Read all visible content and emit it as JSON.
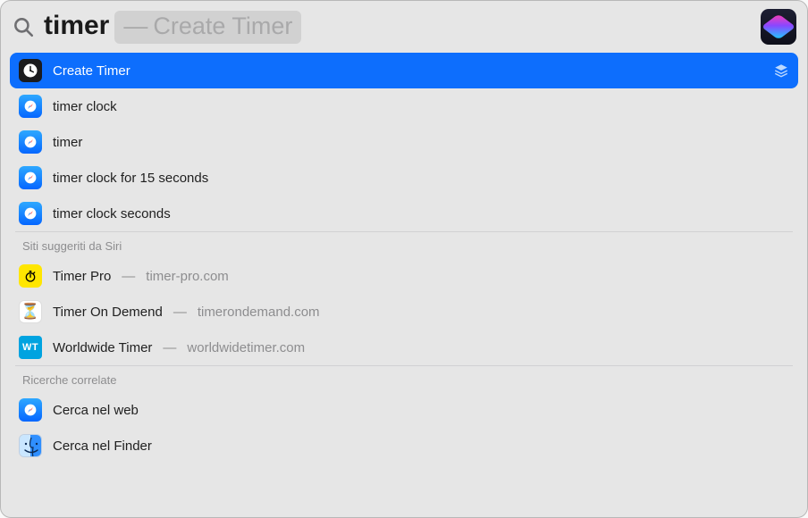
{
  "search": {
    "query": "timer",
    "suggestion_separator": "—",
    "suggestion_text": "Create Timer",
    "app_badge_name": "shortcuts-app-icon"
  },
  "results_primary": [
    {
      "title": "Create Timer",
      "icon": "clock-app-icon",
      "selected": true,
      "trailing_icon": "layers-icon"
    },
    {
      "title": "timer clock",
      "icon": "safari-icon"
    },
    {
      "title": "timer",
      "icon": "safari-icon"
    },
    {
      "title": "timer clock for 15 seconds",
      "icon": "safari-icon"
    },
    {
      "title": "timer clock seconds",
      "icon": "safari-icon"
    }
  ],
  "sections": [
    {
      "header": "Siti suggeriti da Siri",
      "items": [
        {
          "title": "Timer Pro",
          "subtitle_sep": "—",
          "subtitle": "timer-pro.com",
          "icon": "stopwatch-icon"
        },
        {
          "title": "Timer On Demend",
          "subtitle_sep": "—",
          "subtitle": "timerondemand.com",
          "icon": "hourglass-icon"
        },
        {
          "title": "Worldwide Timer",
          "subtitle_sep": "—",
          "subtitle": "worldwidetimer.com",
          "icon": "wt-icon",
          "icon_text": "WT"
        }
      ]
    },
    {
      "header": "Ricerche correlate",
      "items": [
        {
          "title": "Cerca nel web",
          "icon": "safari-icon"
        },
        {
          "title": "Cerca nel Finder",
          "icon": "finder-icon"
        }
      ]
    }
  ]
}
